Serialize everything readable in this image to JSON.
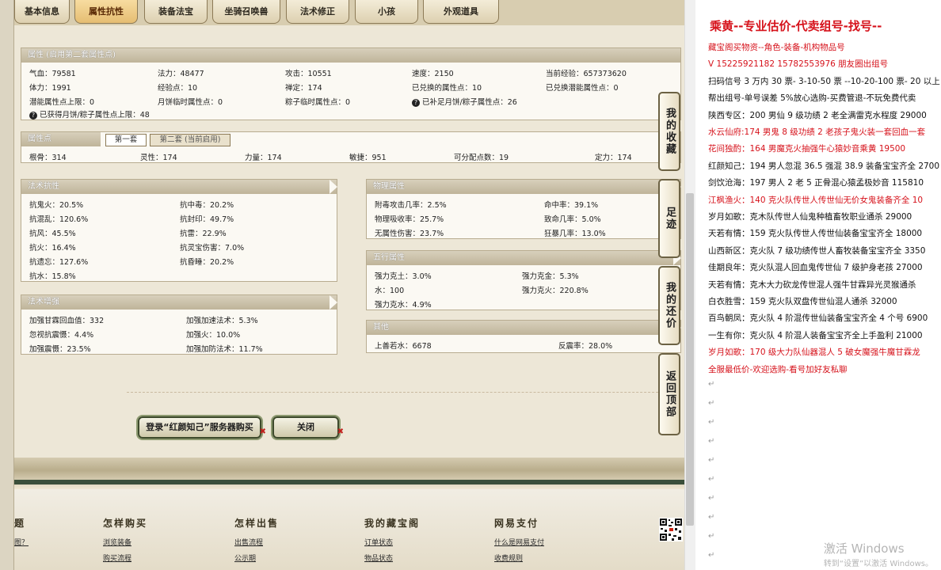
{
  "tabs": [
    "基本信息",
    "属性抗性",
    "装备法宝",
    "坐骑召唤兽",
    "法术修正",
    "小孩",
    "外观道具"
  ],
  "active_tab": "属性抗性",
  "attr_panel": {
    "title": "属性 (启用第二套属性点)",
    "rows": [
      [
        "气血：79581",
        "法力：48477",
        "攻击：10551",
        "速度：2150",
        "当前经验：657373620"
      ],
      [
        "体力：1991",
        "经验点：10",
        "禅定：174",
        "已兑换的属性点：10",
        "已兑换潜能属性点：0"
      ],
      [
        "潜能属性点上限：0",
        "月饼临时属性点：0",
        "粽子临时属性点：0",
        "已补足月饼/粽子属性点：26"
      ]
    ],
    "mooncake_note": "已获得月饼/粽子属性点上限：48"
  },
  "points_panel": {
    "title": "属性点",
    "subtabs": [
      "第一套",
      "第二套 (当前启用)"
    ],
    "values": [
      "根骨：314",
      "灵性：174",
      "力量：174",
      "敏捷：951",
      "可分配点数：19",
      "定力：174"
    ]
  },
  "magic_resist": {
    "title": "法术抗性",
    "left": [
      "抗鬼火：20.5%",
      "抗混乱：120.6%",
      "抗风：45.5%",
      "抗火：16.4%",
      "抗遗忘：127.6%",
      "抗水：15.8%"
    ],
    "right": [
      "抗中毒：20.2%",
      "抗封印：49.7%",
      "抗雷：22.9%",
      "抗灵宝伤害：7.0%",
      "抗昏睡：20.2%"
    ]
  },
  "physical": {
    "title": "物理属性",
    "left": [
      "附毒攻击几率：2.5%",
      "物理吸收率：25.7%",
      "无属性伤害：23.7%"
    ],
    "right": [
      "命中率：39.1%",
      "致命几率：5.0%",
      "狂暴几率：13.0%"
    ]
  },
  "magic_boost": {
    "title": "法术增强",
    "left": [
      "加强甘霖回血值：332",
      "忽视抗震慑：4.4%",
      "加强震慑：23.5%"
    ],
    "right": [
      "加强加速法术：5.3%",
      "加强火：10.0%",
      "加强加防法术：11.7%"
    ]
  },
  "five_elements": {
    "title": "五行属性",
    "left": [
      "强力克土：3.0%",
      "水：100",
      "强力克水：4.9%"
    ],
    "right": [
      "强力克金：5.3%",
      "强力克火：220.8%"
    ]
  },
  "other": {
    "title": "其他",
    "left": "上善若水：6678",
    "right": "反震率：28.0%"
  },
  "side_buttons": [
    "我的收藏",
    "足迹",
    "我的还价",
    "返回顶部"
  ],
  "buttons": {
    "login_buy": "登录“红颜知己”服务器购买",
    "close": "关闭"
  },
  "footer": {
    "cols": [
      {
        "title": "怎样购买",
        "links": [
          "浏览装备",
          "购买流程"
        ]
      },
      {
        "title": "怎样出售",
        "links": [
          "出售流程",
          "公示期"
        ]
      },
      {
        "title": "我的藏宝阁",
        "links": [
          "订单状态",
          "物品状态"
        ]
      },
      {
        "title": "网易支付",
        "links": [
          "什么是网易支付",
          "收费规则"
        ]
      }
    ],
    "partial_left": [
      "题",
      "图？"
    ]
  },
  "right_panel": {
    "title": "乘黄--专业估价-代卖组号-找号--",
    "lines": [
      {
        "text": "藏宝阁买物资--角色-装备-机构物品号",
        "red": true
      },
      {
        "text": "V 15225921182   15782553976 朋友圈出组号",
        "red": true
      },
      {
        "text": "扫码信号 3 万内 30 票- 3-10-50 票  --10-20-100 票- 20 以上 1",
        "red": false
      },
      {
        "text": "帮出组号-单号误差 5%放心选购-买费管退-不玩免费代卖",
        "red": false
      },
      {
        "text": "陕西专区：200 男仙 9 级功绩 2 老全满雷克水程度 29000",
        "red": false
      },
      {
        "text": "水云仙府:174 男鬼 8 级功绩 2 老孩子鬼火装一套回血一套",
        "red": true
      },
      {
        "text": "花间独酌：164 男魔克火抽强牛心猿妙音乘黄 19500",
        "red": true
      },
      {
        "text": "红颜知己：194 男人忽混 36.5 强混 38.9 装备宝宝齐全 2700",
        "red": false
      },
      {
        "text": "剑饮沧海：197 男人 2 老 5 正骨混心猿孟极妙音 115810",
        "red": false
      },
      {
        "text": "江枫渔火：140 克火队传世人传世仙无价女鬼装备齐全 10",
        "red": true
      },
      {
        "text": "岁月如歌：克木队传世人仙鬼种植畜牧职业通杀 29000",
        "red": false
      },
      {
        "text": "天若有情：159 克火队传世人传世仙装备宝宝齐全 18000",
        "red": false
      },
      {
        "text": "山西新区：克火队 7 级功绩传世人畜牧装备宝宝齐全 3350",
        "red": false
      },
      {
        "text": "佳期良年：克火队混人回血鬼传世仙 7 级护身老孩 27000",
        "red": false
      },
      {
        "text": "天若有情：克木大力砍龙传世混人强牛甘霖异光灵猴通杀",
        "red": false
      },
      {
        "text": "白衣胜雪：159 克火队双盘传世仙混人通杀 32000",
        "red": false
      },
      {
        "text": "百鸟朝凤：克火队 4 阶混传世仙装备宝宝齐全 4 个号 6900",
        "red": false
      },
      {
        "text": "一生有你：克火队 4 阶混人装备宝宝齐全上手盈利 21000",
        "red": false
      },
      {
        "text": "岁月如歌：170 级大力队仙器混人 5 破女魔强牛魔甘霖龙",
        "red": true
      },
      {
        "text": "全服最低价-欢迎选购-看号加好友私聊",
        "red": true
      }
    ],
    "return_mark": "↵"
  },
  "watermark": {
    "line1": "激活 Windows",
    "line2": "转到“设置”以激活 Windows。"
  }
}
